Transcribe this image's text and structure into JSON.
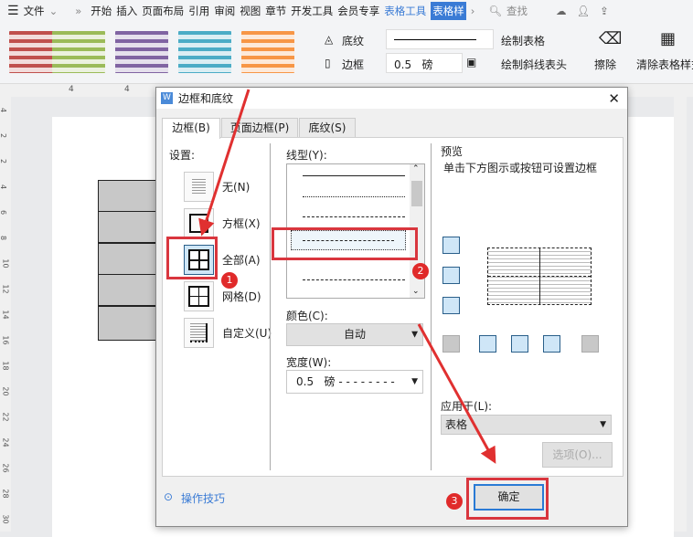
{
  "menubar": {
    "menu_icon": "hamburger-icon",
    "file": "文件",
    "items": [
      "开始",
      "插入",
      "页面布局",
      "引用",
      "审阅",
      "视图",
      "章节",
      "开发工具",
      "会员专享"
    ],
    "table_tools": "表格工具",
    "table_style": "表格样",
    "search": "查找"
  },
  "ribbon": {
    "shading": "底纹",
    "border": "边框",
    "width_value": "0.5",
    "width_unit": "磅",
    "draw_table": "绘制表格",
    "draw_diagonal": "绘制斜线表头",
    "erase": "擦除",
    "clear_style": "清除表格样式",
    "style_colors": [
      "#c0504d",
      "#9bbb59",
      "#8064a2",
      "#4bacc6",
      "#f79646"
    ]
  },
  "ruler": {
    "top_labels": [
      "4",
      "4"
    ],
    "left_labels": [
      "4",
      "2",
      "2",
      "4",
      "6",
      "8",
      "10",
      "12",
      "14",
      "16",
      "18",
      "20",
      "22",
      "24",
      "26",
      "28",
      "30"
    ]
  },
  "dialog": {
    "title": "边框和底纹",
    "tabs": [
      "边框(B)",
      "页面边框(P)",
      "底纹(S)"
    ],
    "settings_label": "设置:",
    "settings": [
      "无(N)",
      "方框(X)",
      "全部(A)",
      "网格(D)",
      "自定义(U)"
    ],
    "line_style_label": "线型(Y):",
    "color_label": "颜色(C):",
    "color_value": "自动",
    "width_label": "宽度(W):",
    "width_value": "0.5",
    "width_unit": "磅",
    "preview_label": "预览",
    "preview_hint": "单击下方图示或按钮可设置边框",
    "apply_label": "应用于(L):",
    "apply_value": "表格",
    "options_button": "选项(O)...",
    "tips_link": "操作技巧",
    "ok_button": "确定"
  },
  "annotations": [
    "1",
    "2",
    "3"
  ],
  "annotation_color": "#d9363e"
}
